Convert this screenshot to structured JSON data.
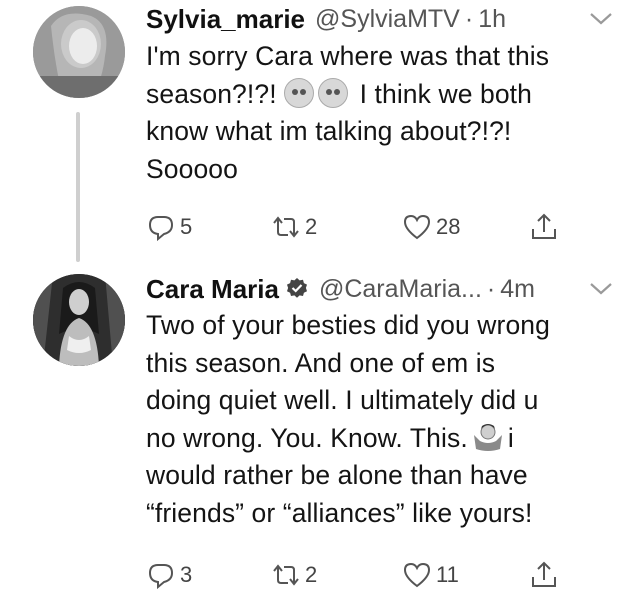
{
  "tweets": [
    {
      "name": "Sylvia_marie",
      "verified": false,
      "handle": "@SylviaMTV",
      "separator": "·",
      "time": "1h",
      "lines": [
        "I'm sorry Cara where was that this",
        "season?!?!",
        "I think we both",
        "know what im talking about?!?!",
        "Sooooo"
      ],
      "replies": "5",
      "retweets": "2",
      "likes": "28"
    },
    {
      "name": "Cara Maria",
      "verified": true,
      "handle": "@CaraMaria...",
      "separator": "·",
      "time": "4m",
      "lines": [
        "Two of your besties did you wrong",
        "this season. And one of em is",
        "doing quiet well. I ultimately did u",
        "no wrong. You. Know. This.",
        "i",
        "would rather be alone than have",
        "“friends” or “alliances” like yours!"
      ],
      "replies": "3",
      "retweets": "2",
      "likes": "11"
    }
  ],
  "icons": {
    "reply": "reply-icon",
    "retweet": "retweet-icon",
    "like": "heart-icon",
    "share": "share-icon",
    "menu": "chevron-down-icon",
    "verified": "verified-badge-icon"
  }
}
